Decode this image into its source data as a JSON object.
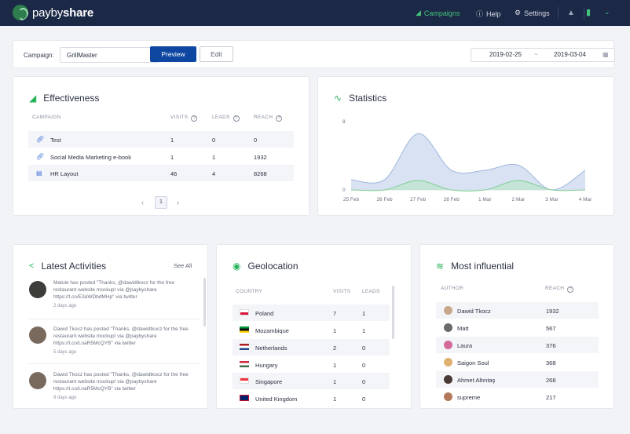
{
  "nav": {
    "brand_light": "payby",
    "brand_bold": "share",
    "campaigns": "Campaigns",
    "help": "Help",
    "settings": "Settings"
  },
  "toolbar": {
    "campaign_label": "Campaign:",
    "campaign_value": "GrillMaster",
    "preview": "Preview",
    "edit": "Edit",
    "date_from": "2019-02-25",
    "date_sep": "~",
    "date_to": "2019-03-04"
  },
  "effectiveness": {
    "title": "Effectiveness",
    "columns": [
      "CAMPAIGN",
      "VISITS",
      "LEADS",
      "REACH"
    ],
    "rows": [
      {
        "name": "Test",
        "visits": "1",
        "leads": "0",
        "reach": "0"
      },
      {
        "name": "Social Media Marketing e-book",
        "visits": "1",
        "leads": "1",
        "reach": "1932"
      },
      {
        "name": "HR Layout",
        "visits": "46",
        "leads": "4",
        "reach": "8268"
      }
    ],
    "page": "1"
  },
  "statistics": {
    "title": "Statistics",
    "chart_data": {
      "type": "area",
      "x": [
        "25 Feb",
        "26 Feb",
        "27 Feb",
        "28 Feb",
        "1 Mar",
        "2 Mar",
        "3 Mar",
        "4 Mar"
      ],
      "y_ticks": [
        "8",
        "0"
      ],
      "ylim": [
        0,
        8
      ],
      "series": [
        {
          "values": [
            1.2,
            1.2,
            6.6,
            2.3,
            2.3,
            2.9,
            0,
            2.3
          ]
        },
        {
          "values": [
            0,
            0,
            1.1,
            0,
            0,
            1.1,
            0,
            0
          ]
        }
      ],
      "colors": [
        "#c8d6ec",
        "#b8e6c4"
      ]
    }
  },
  "activities": {
    "title": "Latest Activities",
    "see_all": "See All",
    "items": [
      {
        "text": "Matule has posted \"Thanks, @dawidtkocz for the free restaurant website mockup! via @paybyshare https://t.co/E3aWDbdMHp\" via twitter",
        "time": "2 days ago"
      },
      {
        "text": "Dawid Tkocz has posted \"Thanks, @dawidtkocz for the free restaurant website mockup! via @paybyshare https://t.co/LnaR5McQYB\" via twitter",
        "time": "5 days ago"
      },
      {
        "text": "Dawid Tkocz has posted \"Thanks, @dawidtkocz for the free restaurant website mockup! via @paybyshare https://t.co/LnaR5McQYB\" via twitter",
        "time": "9 days ago"
      }
    ]
  },
  "geolocation": {
    "title": "Geolocation",
    "columns": [
      "COUNTRY",
      "VISITS",
      "LEADS"
    ],
    "rows": [
      {
        "country": "Poland",
        "visits": "7",
        "leads": "1"
      },
      {
        "country": "Mozambique",
        "visits": "1",
        "leads": "1"
      },
      {
        "country": "Netherlands",
        "visits": "2",
        "leads": "0"
      },
      {
        "country": "Hungary",
        "visits": "1",
        "leads": "0"
      },
      {
        "country": "Singapore",
        "visits": "1",
        "leads": "0"
      },
      {
        "country": "United Kingdom",
        "visits": "1",
        "leads": "0"
      }
    ]
  },
  "influential": {
    "title": "Most influential",
    "columns": [
      "AUTHOR",
      "REACH"
    ],
    "rows": [
      {
        "author": "Dawid Tkocz",
        "reach": "1932"
      },
      {
        "author": "Matt",
        "reach": "567"
      },
      {
        "author": "Laura",
        "reach": "376"
      },
      {
        "author": "Saigon Soul",
        "reach": "368"
      },
      {
        "author": "Ahmet Altıntaş",
        "reach": "268"
      },
      {
        "author": "supreme",
        "reach": "217"
      }
    ]
  }
}
